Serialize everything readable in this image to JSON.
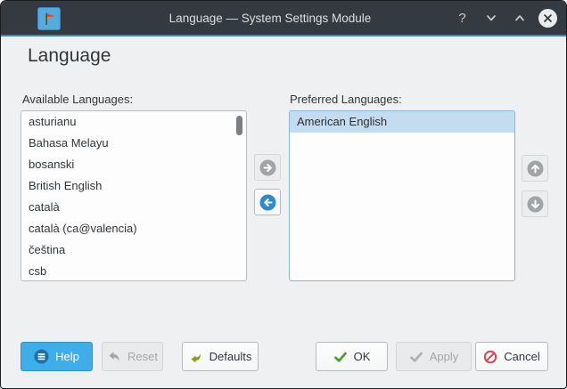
{
  "window": {
    "title": "Language — System Settings Module",
    "controls": {
      "help_glyph": "?"
    }
  },
  "page": {
    "heading": "Language"
  },
  "available": {
    "label": "Available Languages:",
    "items": [
      "asturianu",
      "Bahasa Melayu",
      "bosanski",
      "British English",
      "català",
      "català (ca@valencia)",
      "čeština",
      "csb"
    ]
  },
  "preferred": {
    "label": "Preferred Languages:",
    "items": [
      "American English"
    ],
    "selected": "American English"
  },
  "footer": {
    "help_label": "Help",
    "reset_label": "Reset",
    "defaults_label": "Defaults",
    "ok_label": "OK",
    "apply_label": "Apply",
    "cancel_label": "Cancel"
  },
  "colors": {
    "accent": "#3daee9",
    "titlebar_bg": "#343a41",
    "titlebar_accent_line": "#3e87be",
    "selection_bg": "#c3dcf0",
    "focus_border": "#83b7dc",
    "ok_green": "#4e9a30",
    "cancel_red": "#da4453",
    "defaults_green": "#8aa00a",
    "disabled_gray": "#a4a7a9"
  }
}
